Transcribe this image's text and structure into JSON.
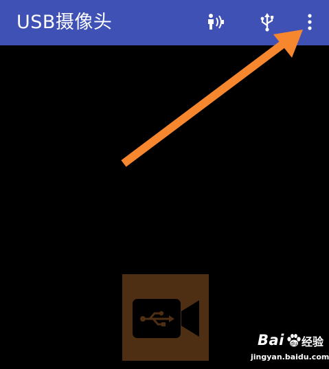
{
  "app": {
    "title": "USB摄像头"
  },
  "toolbar": {
    "actions": [
      {
        "name": "voice-detect-icon"
      },
      {
        "name": "usb-icon"
      },
      {
        "name": "more-vertical-icon"
      }
    ]
  },
  "preview": {
    "placeholder_icon": "usb-camera-icon"
  },
  "annotation": {
    "arrow_color": "#f7872f"
  },
  "watermark": {
    "brand": "Bai",
    "brand_suffix": "经验",
    "url": "jingyan.baidu.com"
  },
  "colors": {
    "appbar": "#3f51b5",
    "background": "#000000",
    "placeholder_bg": "#4e2f13"
  }
}
